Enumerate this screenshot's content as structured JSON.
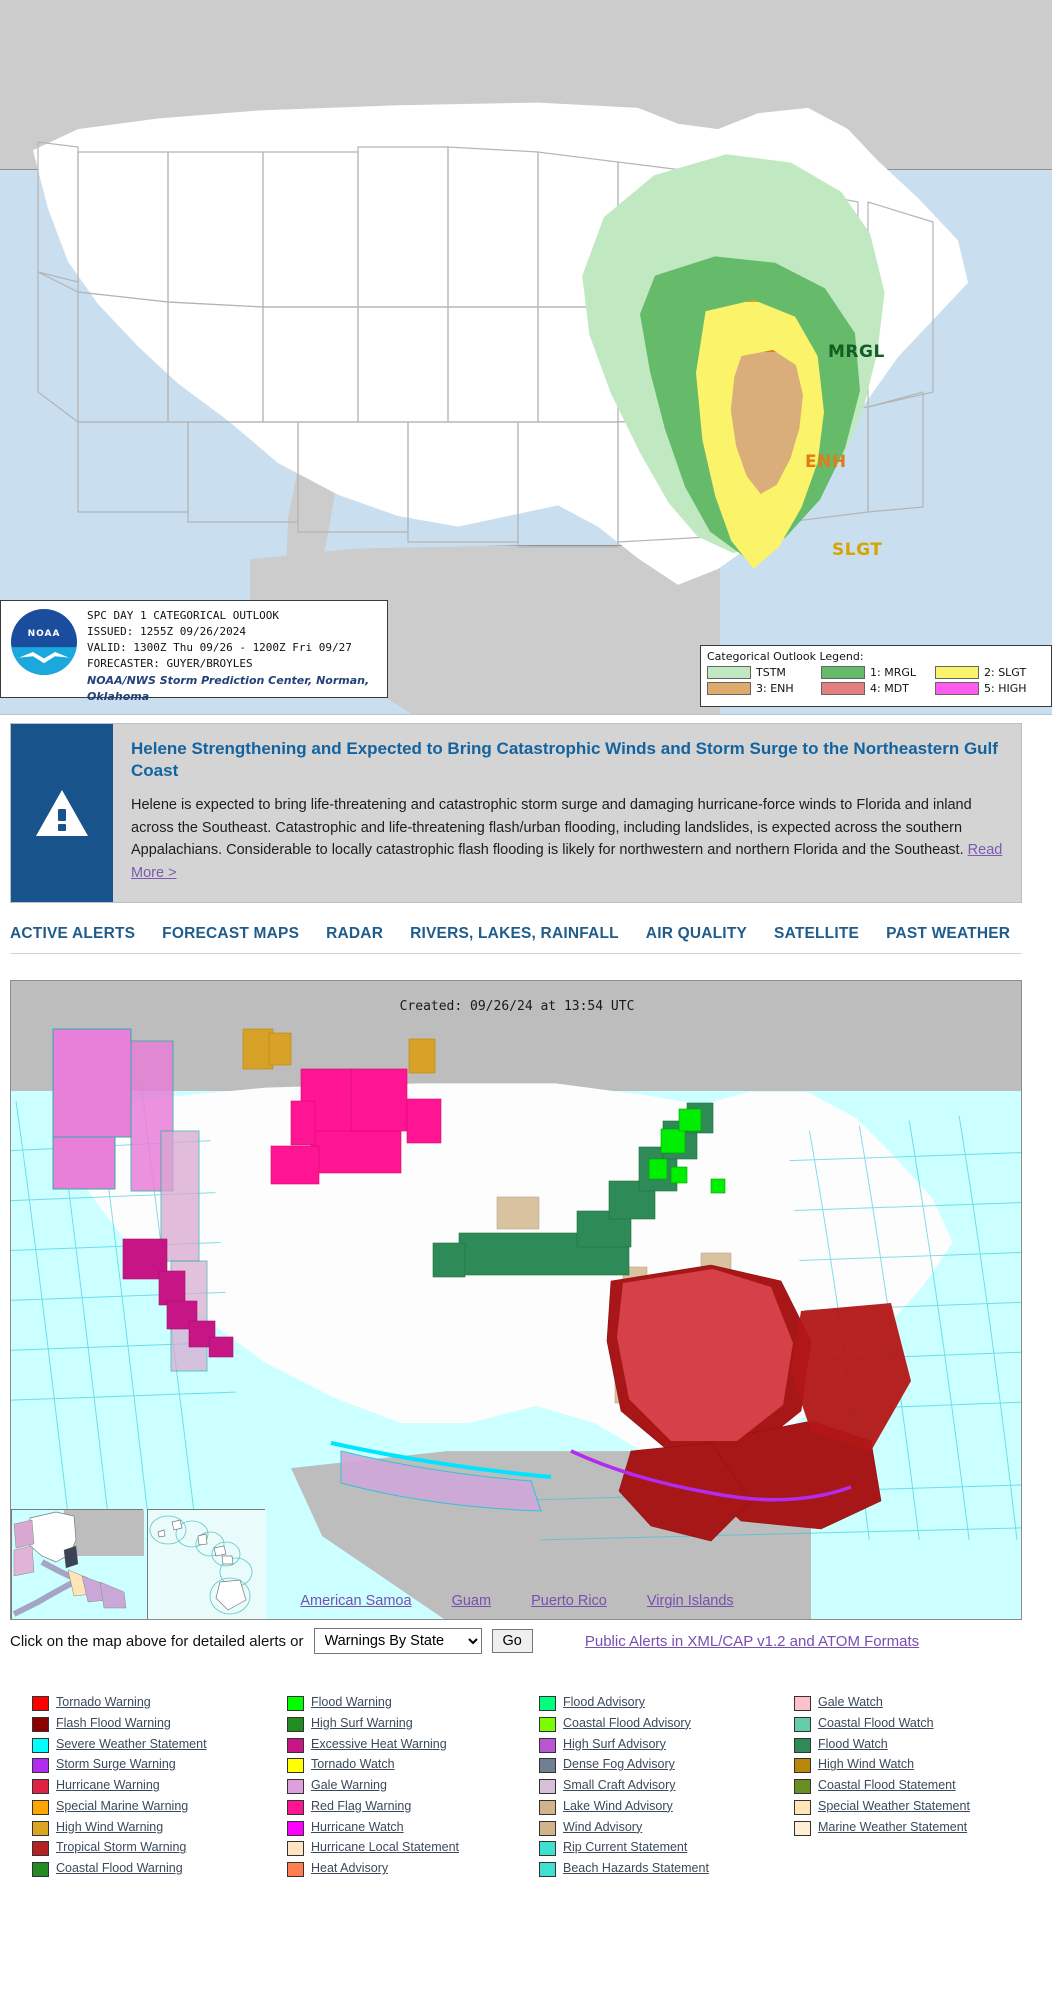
{
  "spc_map": {
    "title": "SPC Day 1 Categorical Outlook",
    "info": {
      "line1": "SPC DAY 1 CATEGORICAL OUTLOOK",
      "line2": "ISSUED: 1255Z 09/26/2024",
      "line3": "VALID: 1300Z Thu 09/26 - 1200Z Fri 09/27",
      "line4": "FORECASTER: GUYER/BROYLES",
      "source": "NOAA/NWS Storm Prediction Center, Norman, Oklahoma",
      "logo_text": "NOAA"
    },
    "legend": {
      "title": "Categorical Outlook Legend:",
      "items": [
        {
          "label": "TSTM",
          "color": "#c1e9c1"
        },
        {
          "label": "1: MRGL",
          "color": "#66bb6a"
        },
        {
          "label": "2: SLGT",
          "color": "#fbf36a"
        },
        {
          "label": "3: ENH",
          "color": "#ddab6e"
        },
        {
          "label": "4: MDT",
          "color": "#e3807f"
        },
        {
          "label": "5: HIGH",
          "color": "#ff5cf0"
        }
      ]
    },
    "area_labels": [
      {
        "text": "MRGL",
        "color": "#125e23"
      },
      {
        "text": "ENH",
        "color": "#e07b1a"
      },
      {
        "text": "SLGT",
        "color": "#d8a200"
      }
    ]
  },
  "alert_banner": {
    "icon": "warning-triangle-icon",
    "headline": "Helene Strengthening and Expected to Bring Catastrophic Winds and Storm Surge to the Northeastern Gulf Coast",
    "body": "Helene is expected to bring life-threatening and catastrophic storm surge and damaging hurricane-force winds to Florida and inland across the Southeast. Catastrophic and life-threatening flash/urban flooding, including landslides, is expected across the southern Appalachians. Considerable to locally catastrophic flash flooding is likely for northwestern and northern Florida and the Southeast.",
    "read_more": "Read More >",
    "accent_color": "#18538c",
    "headline_color": "#14639e"
  },
  "nav_tabs": [
    {
      "label": "ACTIVE ALERTS"
    },
    {
      "label": "FORECAST MAPS"
    },
    {
      "label": "RADAR"
    },
    {
      "label": "RIVERS, LAKES, RAINFALL"
    },
    {
      "label": "AIR QUALITY"
    },
    {
      "label": "SATELLITE"
    },
    {
      "label": "PAST WEATHER"
    }
  ],
  "alerts_map": {
    "created_text": "Created: 09/26/24 at 13:54 UTC",
    "territory_links": [
      {
        "label": "American Samoa"
      },
      {
        "label": "Guam"
      },
      {
        "label": "Puerto Rico"
      },
      {
        "label": "Virgin Islands"
      }
    ]
  },
  "map_controls": {
    "instruction": "Click on the map above for detailed alerts or",
    "select_value": "Warnings By State",
    "go_label": "Go",
    "xml_link": "Public Alerts in XML/CAP v1.2 and ATOM Formats"
  },
  "legend_columns": [
    {
      "items": [
        {
          "label": "Tornado Warning",
          "color": "#ff0000"
        },
        {
          "label": "Flash Flood Warning",
          "color": "#8b0000"
        },
        {
          "label": "Severe Weather Statement",
          "color": "#00ffff"
        },
        {
          "label": "Storm Surge Warning",
          "color": "#b22cf0"
        },
        {
          "label": "Hurricane Warning",
          "color": "#dd2244"
        },
        {
          "label": "Special Marine Warning",
          "color": "#ffa500"
        },
        {
          "label": "High Wind Warning",
          "color": "#daa520"
        },
        {
          "label": "Tropical Storm Warning",
          "color": "#b22222"
        },
        {
          "label": "Coastal Flood Warning",
          "color": "#228b22"
        }
      ]
    },
    {
      "items": [
        {
          "label": "Flood Warning",
          "color": "#00ff00"
        },
        {
          "label": "High Surf Warning",
          "color": "#228b22"
        },
        {
          "label": "Excessive Heat Warning",
          "color": "#c71585"
        },
        {
          "label": "Tornado Watch",
          "color": "#ffff00"
        },
        {
          "label": "Gale Warning",
          "color": "#dda0dd"
        },
        {
          "label": "Red Flag Warning",
          "color": "#ff1493"
        },
        {
          "label": "Hurricane Watch",
          "color": "#ff00ff"
        },
        {
          "label": "Hurricane Local Statement",
          "color": "#ffe4c4"
        },
        {
          "label": "Heat Advisory",
          "color": "#ff7f50"
        }
      ]
    },
    {
      "items": [
        {
          "label": "Flood Advisory",
          "color": "#00ff7f"
        },
        {
          "label": "Coastal Flood Advisory",
          "color": "#7cfc00"
        },
        {
          "label": "High Surf Advisory",
          "color": "#ba55d3"
        },
        {
          "label": "Dense Fog Advisory",
          "color": "#708090"
        },
        {
          "label": "Small Craft Advisory",
          "color": "#d8bfd8"
        },
        {
          "label": "Lake Wind Advisory",
          "color": "#d2b48c"
        },
        {
          "label": "Wind Advisory",
          "color": "#d2b48c"
        },
        {
          "label": "Rip Current Statement",
          "color": "#40e0d0"
        },
        {
          "label": "Beach Hazards Statement",
          "color": "#40e0d0"
        }
      ]
    },
    {
      "items": [
        {
          "label": "Gale Watch",
          "color": "#ffc0cb"
        },
        {
          "label": "Coastal Flood Watch",
          "color": "#66cdaa"
        },
        {
          "label": "Flood Watch",
          "color": "#2e8b57"
        },
        {
          "label": "High Wind Watch",
          "color": "#b8860b"
        },
        {
          "label": "Coastal Flood Statement",
          "color": "#6b8e23"
        },
        {
          "label": "Special Weather Statement",
          "color": "#ffe4b5"
        },
        {
          "label": "Marine Weather Statement",
          "color": "#ffefd5"
        }
      ]
    }
  ]
}
